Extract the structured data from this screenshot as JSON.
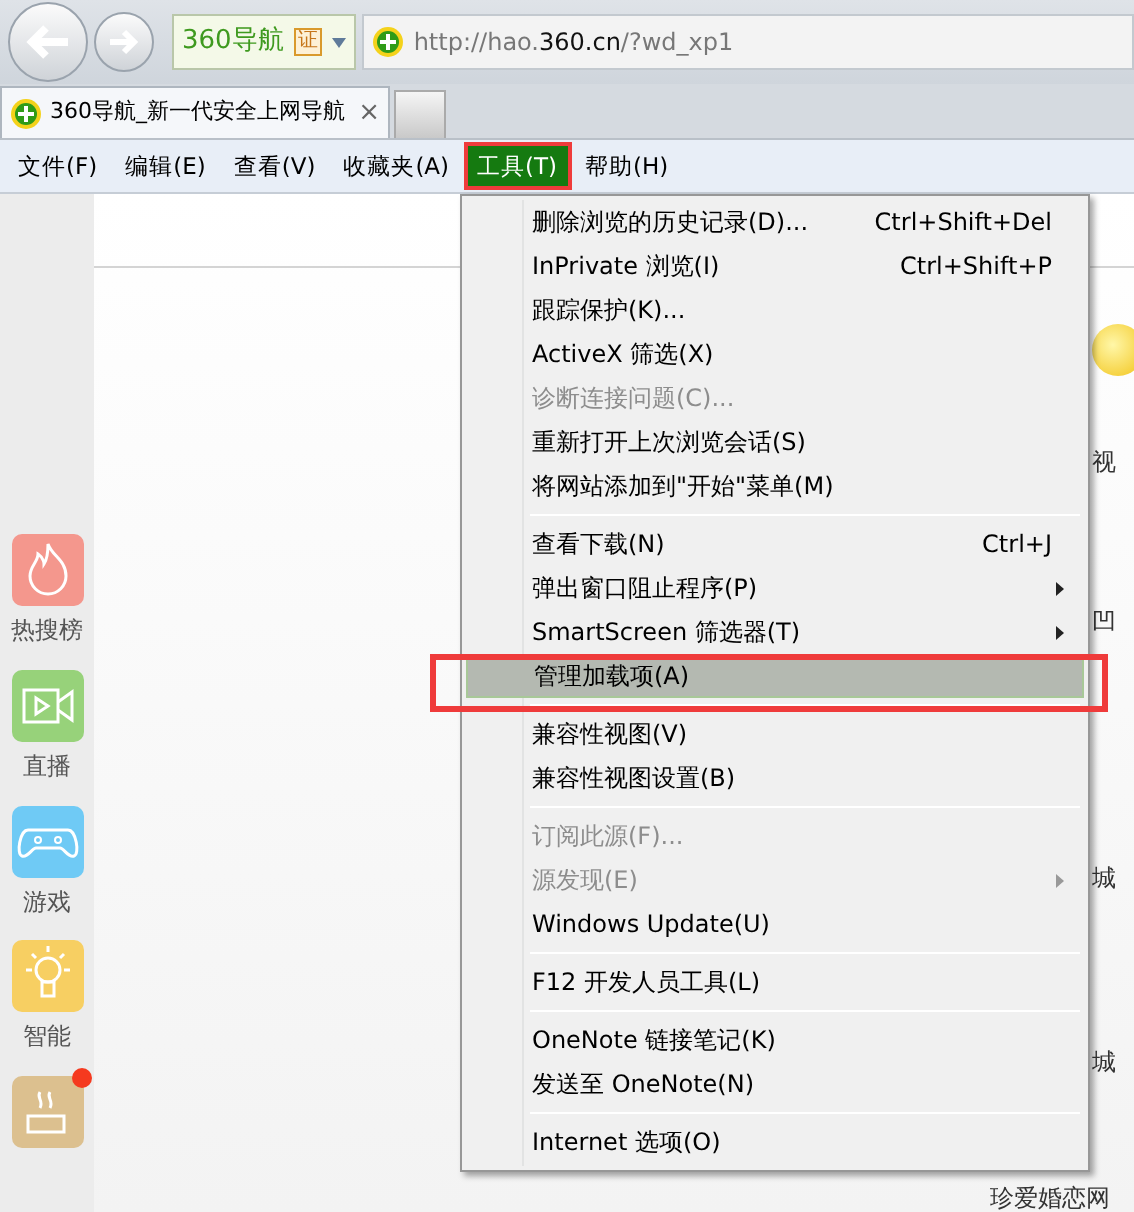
{
  "toolbar": {
    "site_label": "360导航",
    "cert_badge": "证",
    "address": "http://hao.**360.cn**/?wd_xp1"
  },
  "tabs": [
    {
      "title": "360导航_新一代安全上网导航",
      "close": "×",
      "selected": true
    }
  ],
  "menu_bar": [
    {
      "label": "文件(F)",
      "selected": false
    },
    {
      "label": "编辑(E)",
      "selected": false
    },
    {
      "label": "查看(V)",
      "selected": false
    },
    {
      "label": "收藏夹(A)",
      "selected": false
    },
    {
      "label": "工具(T)",
      "selected": true
    },
    {
      "label": "帮助(H)",
      "selected": false
    }
  ],
  "tools_menu": [
    {
      "kind": "item",
      "label": "删除浏览的历史记录(D)...",
      "shortcut": "Ctrl+Shift+Del",
      "disabled": false,
      "submenu": false,
      "selected": false
    },
    {
      "kind": "item",
      "label": "InPrivate 浏览(I)",
      "shortcut": "Ctrl+Shift+P",
      "disabled": false,
      "submenu": false,
      "selected": false
    },
    {
      "kind": "item",
      "label": "跟踪保护(K)...",
      "disabled": false,
      "submenu": false,
      "selected": false
    },
    {
      "kind": "item",
      "label": "ActiveX 筛选(X)",
      "disabled": false,
      "submenu": false,
      "selected": false
    },
    {
      "kind": "item",
      "label": "诊断连接问题(C)...",
      "disabled": true,
      "submenu": false,
      "selected": false
    },
    {
      "kind": "item",
      "label": "重新打开上次浏览会话(S)",
      "disabled": false,
      "submenu": false,
      "selected": false
    },
    {
      "kind": "item",
      "label": "将网站添加到\"开始\"菜单(M)",
      "disabled": false,
      "submenu": false,
      "selected": false
    },
    {
      "kind": "separator"
    },
    {
      "kind": "item",
      "label": "查看下载(N)",
      "shortcut": "Ctrl+J",
      "disabled": false,
      "submenu": false,
      "selected": false
    },
    {
      "kind": "item",
      "label": "弹出窗口阻止程序(P)",
      "disabled": false,
      "submenu": true,
      "selected": false
    },
    {
      "kind": "item",
      "label": "SmartScreen 筛选器(T)",
      "disabled": false,
      "submenu": true,
      "selected": false
    },
    {
      "kind": "item",
      "label": "管理加载项(A)",
      "disabled": false,
      "submenu": false,
      "selected": true
    },
    {
      "kind": "separator"
    },
    {
      "kind": "item",
      "label": "兼容性视图(V)",
      "disabled": false,
      "submenu": false,
      "selected": false
    },
    {
      "kind": "item",
      "label": "兼容性视图设置(B)",
      "disabled": false,
      "submenu": false,
      "selected": false
    },
    {
      "kind": "separator"
    },
    {
      "kind": "item",
      "label": "订阅此源(F)...",
      "disabled": true,
      "submenu": false,
      "selected": false
    },
    {
      "kind": "item",
      "label": "源发现(E)",
      "disabled": true,
      "submenu": true,
      "selected": false
    },
    {
      "kind": "item",
      "label": "Windows Update(U)",
      "disabled": false,
      "submenu": false,
      "selected": false
    },
    {
      "kind": "separator"
    },
    {
      "kind": "item",
      "label": "F12 开发人员工具(L)",
      "disabled": false,
      "submenu": false,
      "selected": false
    },
    {
      "kind": "separator"
    },
    {
      "kind": "item",
      "label": "OneNote 链接笔记(K)",
      "disabled": false,
      "submenu": false,
      "selected": false
    },
    {
      "kind": "item",
      "label": "发送至 OneNote(N)",
      "disabled": false,
      "submenu": false,
      "selected": false
    },
    {
      "kind": "separator"
    },
    {
      "kind": "item",
      "label": "Internet 选项(O)",
      "disabled": false,
      "submenu": false,
      "selected": false
    }
  ],
  "sidebar": [
    {
      "kind": "flame",
      "label": "热搜榜",
      "color": "#f4978d",
      "badge": false
    },
    {
      "kind": "video",
      "label": "直播",
      "color": "#97d27a",
      "badge": false
    },
    {
      "kind": "gamepad",
      "label": "游戏",
      "color": "#6fcaf5",
      "badge": false
    },
    {
      "kind": "bulb",
      "label": "智能",
      "color": "#f7cf62",
      "badge": false
    },
    {
      "kind": "cup",
      "color": "#dcc08f",
      "badge": true
    }
  ],
  "page": {
    "right_fragments": [
      "视",
      "凹",
      "城",
      "城"
    ],
    "bottom_link": "珍爱婚恋网"
  }
}
